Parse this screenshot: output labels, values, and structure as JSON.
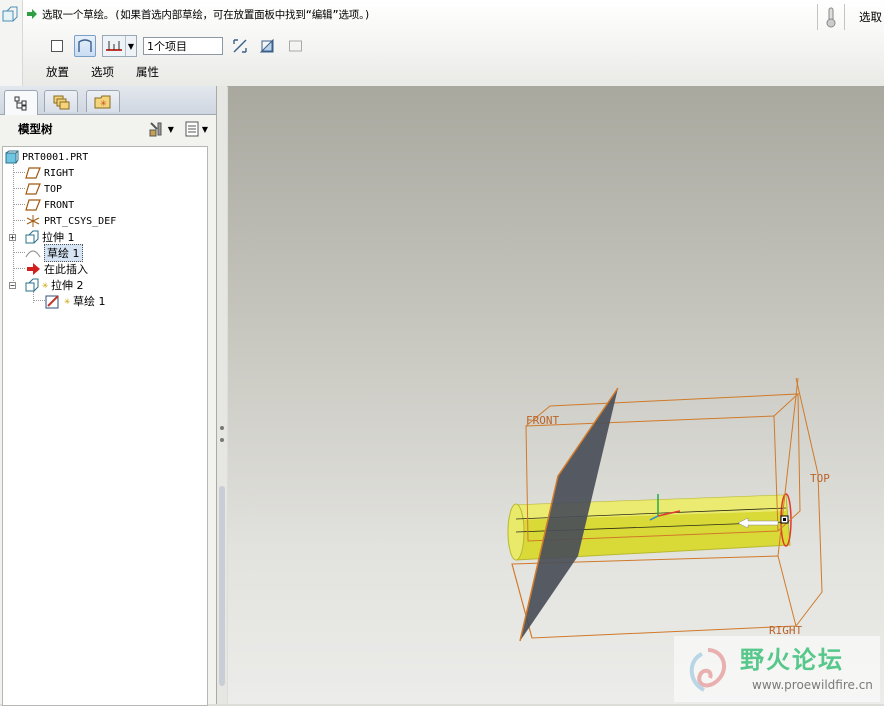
{
  "dashboard": {
    "prompt": "选取一个草绘。(如果首选内部草绘，可在放置面板中找到“编辑”选项。)",
    "collector_value": "1个项目",
    "tabs": [
      {
        "label": "放置"
      },
      {
        "label": "选项"
      },
      {
        "label": "属性"
      }
    ],
    "select_label": "选取"
  },
  "navigator": {
    "title": "模型树",
    "tabs": [
      {
        "icon": "model-tree-icon"
      },
      {
        "icon": "folder-browser-icon"
      },
      {
        "icon": "favorites-icon"
      }
    ]
  },
  "tree": {
    "items": [
      {
        "label": "PRT0001.PRT",
        "icon": "part-icon"
      },
      {
        "label": "RIGHT",
        "icon": "datum-plane-icon"
      },
      {
        "label": "TOP",
        "icon": "datum-plane-icon"
      },
      {
        "label": "FRONT",
        "icon": "datum-plane-icon"
      },
      {
        "label": "PRT_CSYS_DEF",
        "icon": "csys-icon"
      },
      {
        "label": "拉伸 1",
        "icon": "extrude-icon"
      },
      {
        "label": "草绘 1",
        "icon": "sketch-icon"
      },
      {
        "label": "在此插入",
        "icon": "insert-here-icon"
      },
      {
        "label": "拉伸 2",
        "icon": "extrude-new-icon"
      },
      {
        "label": "草绘 1",
        "icon": "sketch-edit-icon"
      }
    ]
  },
  "graphics": {
    "datum_labels": [
      "FRONT",
      "TOP",
      "RIGHT"
    ]
  },
  "watermark": {
    "cn": "野火论坛",
    "en": "www.proewildfire.cn"
  },
  "colors": {
    "datum_orange": "#d07a2a",
    "cylinder_yellow": "#e8e84a",
    "plane_gray": "#4a4e58",
    "selection_blue": "#d7e4f4"
  }
}
